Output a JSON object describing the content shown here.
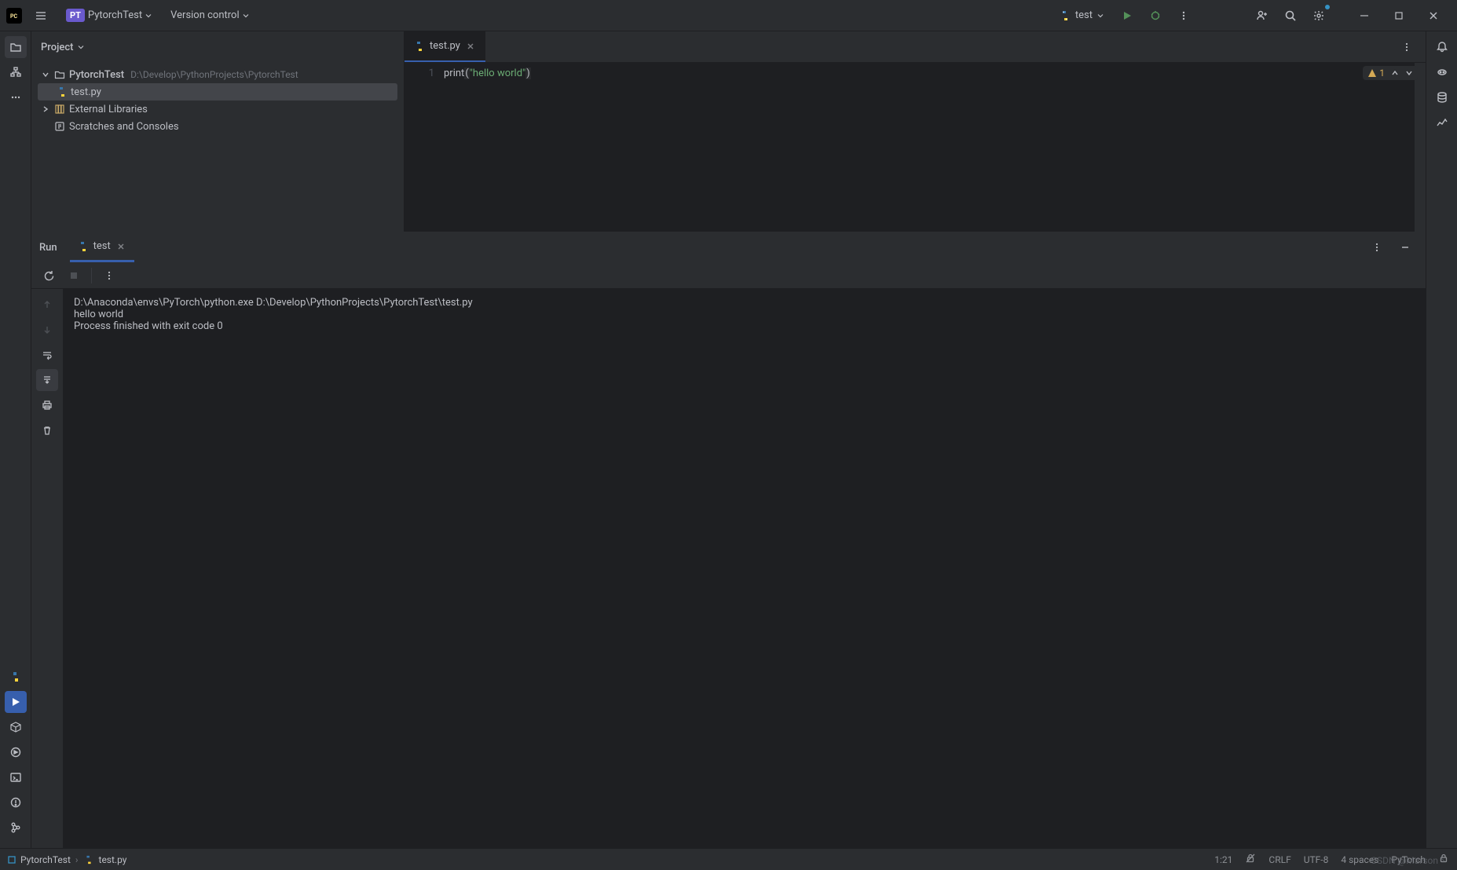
{
  "titlebar": {
    "project_badge": "PT",
    "project_name": "PytorchTest",
    "version_control": "Version control"
  },
  "run_config": {
    "label": "test"
  },
  "project_panel": {
    "title": "Project"
  },
  "tree": {
    "root_name": "PytorchTest",
    "root_path": "D:\\Develop\\PythonProjects\\PytorchTest",
    "file_name": "test.py",
    "external_libs": "External Libraries",
    "scratches": "Scratches and Consoles"
  },
  "editor": {
    "tab_name": "test.py",
    "line_number": "1",
    "code_fn": "print",
    "code_str": "\"hello world\"",
    "warning_count": "1"
  },
  "run_panel": {
    "title": "Run",
    "tab_name": "test",
    "output_line1": "D:\\Anaconda\\envs\\PyTorch\\python.exe D:\\Develop\\PythonProjects\\PytorchTest\\test.py",
    "output_line2": "hello world",
    "output_line3": "",
    "output_line4": "Process finished with exit code 0"
  },
  "breadcrumb": {
    "project": "PytorchTest",
    "file": "test.py"
  },
  "statusbar": {
    "position": "1:21",
    "line_sep": "CRLF",
    "encoding": "UTF-8",
    "indent": "4 spaces",
    "interpreter": "PyTorch"
  },
  "watermark": "CSDN @Marson丶"
}
